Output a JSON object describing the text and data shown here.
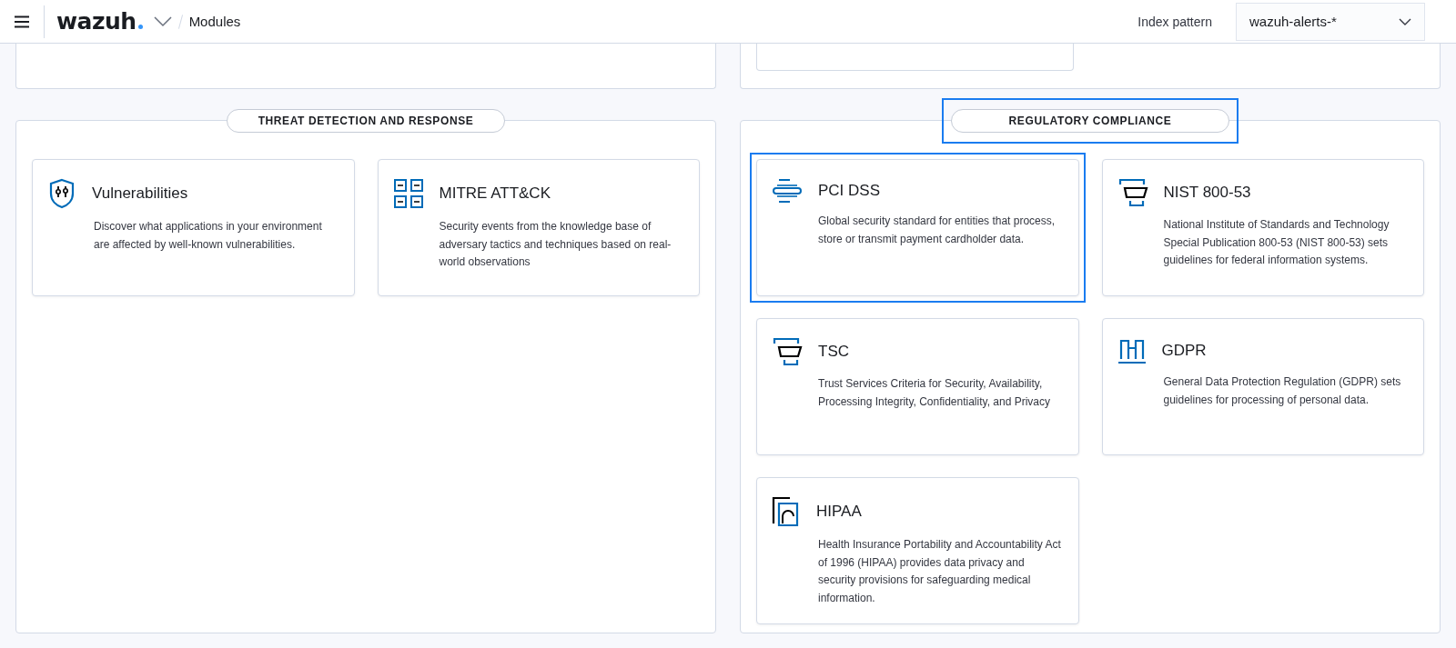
{
  "header": {
    "brand": "wazuh",
    "breadcrumb": "Modules",
    "index_pattern": {
      "label": "Index pattern",
      "value": "wazuh-alerts-*"
    }
  },
  "sections": [
    {
      "title": "THREAT DETECTION AND RESPONSE",
      "highlighted": false,
      "modules": [
        {
          "kind": "shield",
          "title": "Vulnerabilities",
          "description": "Discover what applications in your environment are affected by well-known vulnerabilities.",
          "highlighted": false
        },
        {
          "kind": "grid",
          "title": "MITRE ATT&CK",
          "description": "Security events from the knowledge base of adversary tactics and techniques based on real-world observations",
          "highlighted": false
        }
      ]
    },
    {
      "title": "REGULATORY COMPLIANCE",
      "highlighted": true,
      "modules": [
        {
          "kind": "lines",
          "title": "PCI DSS",
          "description": "Global security standard for entities that process, store or transmit payment cardholder data.",
          "highlighted": true
        },
        {
          "kind": "frame",
          "title": "NIST 800-53",
          "description": "National Institute of Standards and Technology Special Publication 800-53 (NIST 800-53) sets guidelines for federal information systems.",
          "highlighted": false
        },
        {
          "kind": "frame",
          "title": "TSC",
          "description": "Trust Services Criteria for Security, Availability, Processing Integrity, Confidentiality, and Privacy",
          "highlighted": false
        },
        {
          "kind": "columns",
          "title": "GDPR",
          "description": "General Data Protection Regulation (GDPR) sets guidelines for processing of personal data.",
          "highlighted": false
        },
        {
          "kind": "document",
          "title": "HIPAA",
          "description": "Health Insurance Portability and Accountability Act of 1996 (HIPAA) provides data privacy and security provisions for safeguarding medical information.",
          "highlighted": false
        }
      ]
    }
  ]
}
